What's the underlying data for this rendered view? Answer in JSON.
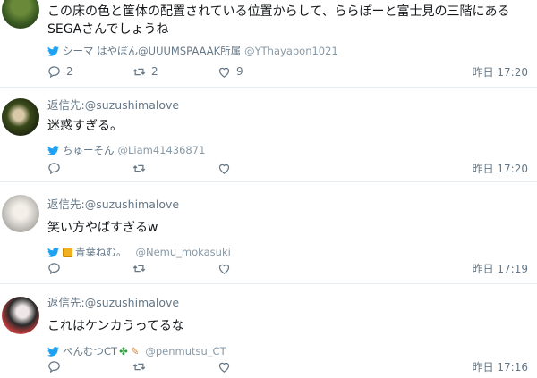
{
  "tweets": [
    {
      "reply_prefix": "",
      "reply_handle": "",
      "text_line1": "この床の色と筐体の配置されている位置からして、ららぽーと富士見の三階にある",
      "text_line2": "SEGAさんでしょうね",
      "via_user": "シーマ はやぽん@UUUMSPAAAK所属",
      "via_screen": "@YThayapon1021",
      "reply_count": "2",
      "retweet_count": "2",
      "like_count": "9",
      "time": "昨日 17:20"
    },
    {
      "reply_prefix": "返信先:",
      "reply_handle": "@suzushimalove",
      "text": "迷惑すぎる。",
      "via_user": "ちゅーそん",
      "via_screen": "@Liam41436871",
      "time": "昨日 17:20"
    },
    {
      "reply_prefix": "返信先:",
      "reply_handle": "@suzushimalove",
      "text": "笑い方やばすぎるw",
      "via_user": "青葉ねむ。",
      "via_screen": "@Nemu_mokasuki",
      "time": "昨日 17:19"
    },
    {
      "reply_prefix": "返信先:",
      "reply_handle": "@suzushimalove",
      "text": "これはケンカうってるな",
      "via_user": "ぺんむつCT",
      "via_screen": "@penmutsu_CT",
      "time": "昨日 17:16"
    }
  ],
  "icons": {
    "reply": "reply-icon",
    "retweet": "retweet-icon",
    "like": "heart-icon",
    "via": "twitter-bird-icon"
  },
  "colors": {
    "muted": "#657786",
    "divider": "#e6ecf0",
    "text": "#14171a"
  }
}
